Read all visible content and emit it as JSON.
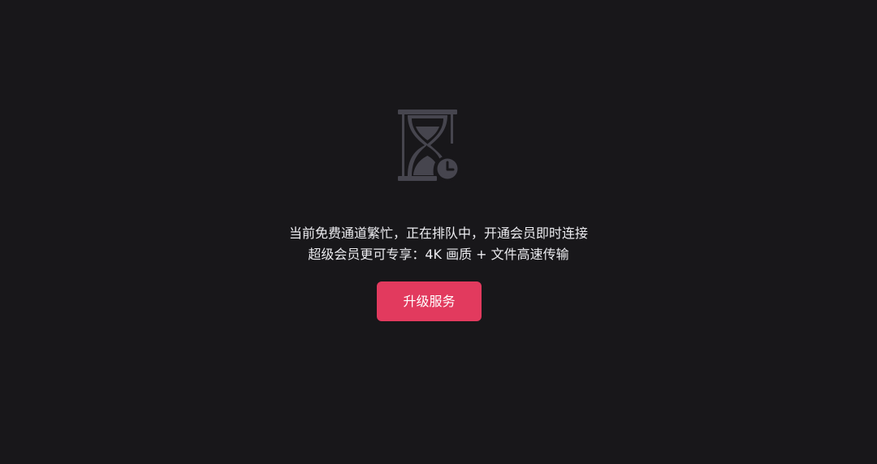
{
  "overlay": {
    "icon": "hourglass-clock-icon",
    "message_line1": "当前免费通道繁忙，正在排队中，开通会员即时连接",
    "message_line2": "超级会员更可专享：4K 画质 + 文件高速传输",
    "upgrade_button_label": "升级服务"
  },
  "colors": {
    "background": "#18171a",
    "icon": "#46454e",
    "text": "#ececf0",
    "accent": "#e23a5e"
  }
}
